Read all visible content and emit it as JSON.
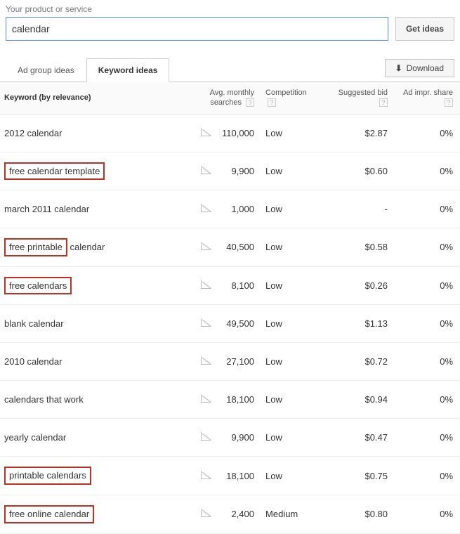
{
  "search": {
    "label": "Your product or service",
    "value": "calendar",
    "button": "Get ideas"
  },
  "tabs": {
    "adgroup": "Ad group ideas",
    "keyword": "Keyword ideas"
  },
  "download_label": "Download",
  "columns": {
    "keyword": "Keyword (by relevance)",
    "searches_l1": "Avg. monthly",
    "searches_l2": "searches",
    "competition": "Competition",
    "bid": "Suggested bid",
    "share": "Ad impr. share"
  },
  "help_glyph": "?",
  "rows": [
    {
      "keyword": "2012 calendar",
      "highlight": false,
      "searches": "110,000",
      "competition": "Low",
      "bid": "$2.87",
      "share": "0%"
    },
    {
      "keyword": "free calendar template",
      "highlight": true,
      "searches": "9,900",
      "competition": "Low",
      "bid": "$0.60",
      "share": "0%"
    },
    {
      "keyword": "march 2011 calendar",
      "highlight": false,
      "searches": "1,000",
      "competition": "Low",
      "bid": "-",
      "share": "0%"
    },
    {
      "keyword": "free printable calendar",
      "highlight": true,
      "hl_partial": "free printable",
      "hl_rest": " calendar",
      "searches": "40,500",
      "competition": "Low",
      "bid": "$0.58",
      "share": "0%"
    },
    {
      "keyword": "free calendars",
      "highlight": true,
      "searches": "8,100",
      "competition": "Low",
      "bid": "$0.26",
      "share": "0%"
    },
    {
      "keyword": "blank calendar",
      "highlight": false,
      "searches": "49,500",
      "competition": "Low",
      "bid": "$1.13",
      "share": "0%"
    },
    {
      "keyword": "2010 calendar",
      "highlight": false,
      "searches": "27,100",
      "competition": "Low",
      "bid": "$0.72",
      "share": "0%"
    },
    {
      "keyword": "calendars that work",
      "highlight": false,
      "searches": "18,100",
      "competition": "Low",
      "bid": "$0.94",
      "share": "0%"
    },
    {
      "keyword": "yearly calendar",
      "highlight": false,
      "searches": "9,900",
      "competition": "Low",
      "bid": "$0.47",
      "share": "0%"
    },
    {
      "keyword": "printable calendars",
      "highlight": true,
      "searches": "18,100",
      "competition": "Low",
      "bid": "$0.75",
      "share": "0%"
    },
    {
      "keyword": "free online calendar",
      "highlight": true,
      "searches": "2,400",
      "competition": "Medium",
      "bid": "$0.80",
      "share": "0%"
    }
  ]
}
